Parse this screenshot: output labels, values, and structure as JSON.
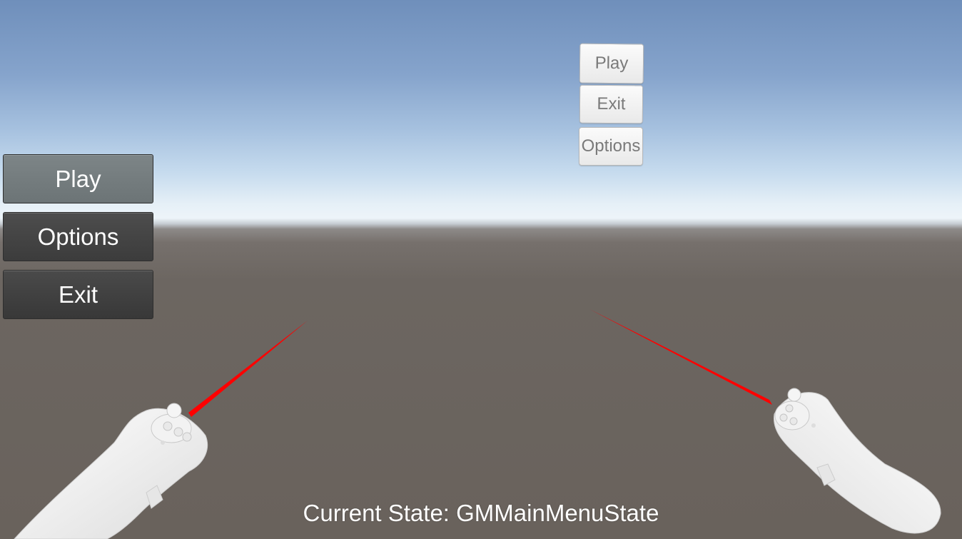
{
  "screen_menu": {
    "play_label": "Play",
    "options_label": "Options",
    "exit_label": "Exit"
  },
  "world_menu": {
    "play_label": "Play",
    "exit_label": "Exit",
    "options_label": "Options"
  },
  "status": {
    "text": "Current State: GMMainMenuState"
  },
  "colors": {
    "laser": "#ff0000",
    "controller": "#f3f3f3",
    "sky_top": "#6f8fbb",
    "horizon": "#edf4f9",
    "ground": "#69625c"
  },
  "icons": {
    "left_controller": "vr-controller-left-icon",
    "right_controller": "vr-controller-right-icon"
  }
}
